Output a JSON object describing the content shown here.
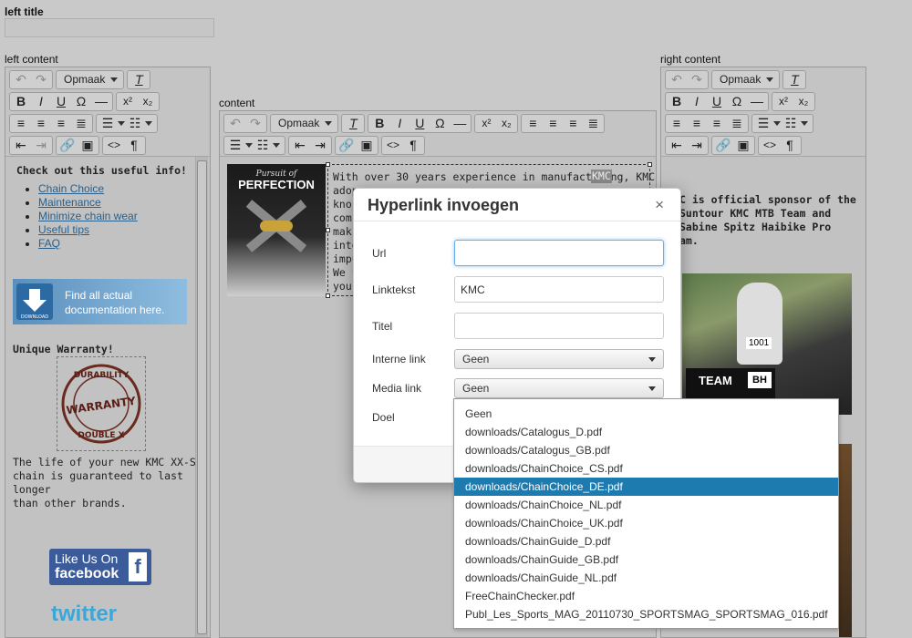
{
  "labels": {
    "left_title": "left title",
    "left_content": "left content",
    "content": "content",
    "right_content": "right content"
  },
  "toolbar": {
    "format_label": "Opmaak",
    "omega": "Ω",
    "pilcrow": "¶",
    "source": "<>"
  },
  "left_panel": {
    "heading": "Check out this useful info!",
    "links": [
      "Chain Choice",
      "Maintenance",
      "Minimize chain wear",
      "Useful tips",
      "FAQ"
    ],
    "doc_banner_line1": "Find all actual",
    "doc_banner_line2": "documentation here.",
    "doc_banner_icon_text": "DOWNLOAD",
    "warranty_heading": "Unique Warranty!",
    "warranty_stamp_top": "DURABILITY",
    "warranty_stamp_mid": "WARRANTY",
    "warranty_stamp_bot": "DOUBLE X",
    "warranty_text_1": "The life of your new KMC XX-SP",
    "warranty_text_2": "chain is guaranteed to last longer",
    "warranty_text_3": "than other brands.",
    "facebook_line1": "Like Us On",
    "facebook_line2": "facebook",
    "facebook_icon": "f",
    "twitter": "twitter"
  },
  "content_panel": {
    "image_tagline": "Pursuit of",
    "image_title": "PERFECTION",
    "text_lines": [
      "With over 30 years experience in manufacturing, KMC",
      "adop",
      "kno",
      "com",
      "mak",
      "inte",
      "impu",
      "We f",
      "you"
    ],
    "highlight": "KMC"
  },
  "right_panel": {
    "text_lines": [
      "C is official sponsor of the",
      "Suntour KMC MTB Team and",
      "Sabine Spitz Haibike Pro",
      "am."
    ],
    "photo_team_text": "TEAM",
    "photo_bh_text": "BH",
    "photo_race_number": "1001"
  },
  "modal": {
    "title": "Hyperlink invoegen",
    "close": "×",
    "url_label": "Url",
    "url_value": "",
    "linktext_label": "Linktekst",
    "linktext_value": "KMC",
    "title_label": "Titel",
    "title_value": "",
    "internal_label": "Interne link",
    "internal_value": "Geen",
    "media_label": "Media link",
    "media_value": "Geen",
    "target_label": "Doel"
  },
  "media_dropdown": {
    "selected_index": 4,
    "options": [
      "Geen",
      "downloads/Catalogus_D.pdf",
      "downloads/Catalogus_GB.pdf",
      "downloads/ChainChoice_CS.pdf",
      "downloads/ChainChoice_DE.pdf",
      "downloads/ChainChoice_NL.pdf",
      "downloads/ChainChoice_UK.pdf",
      "downloads/ChainGuide_D.pdf",
      "downloads/ChainGuide_GB.pdf",
      "downloads/ChainGuide_NL.pdf",
      "FreeChainChecker.pdf",
      "Publ_Les_Sports_MAG_20110730_SPORTSMAG_SPORTSMAG_016.pdf"
    ]
  },
  "colors": {
    "accent": "#1e7bb0",
    "link": "#2a5f8a",
    "focus": "#66afe9"
  }
}
